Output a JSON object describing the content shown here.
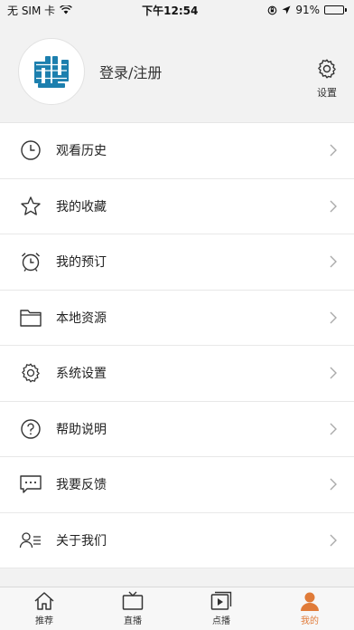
{
  "status": {
    "carrier": "无 SIM 卡",
    "time": "下午12:54",
    "battery": "91%",
    "battery_level": 0.91
  },
  "profile": {
    "login_label": "登录/注册",
    "settings_label": "设置"
  },
  "menu": [
    {
      "label": "观看历史",
      "icon": "clock-icon"
    },
    {
      "label": "我的收藏",
      "icon": "star-icon"
    },
    {
      "label": "我的预订",
      "icon": "alarm-clock-icon"
    },
    {
      "label": "本地资源",
      "icon": "folder-icon"
    },
    {
      "label": "系统设置",
      "icon": "gear-icon"
    },
    {
      "label": "帮助说明",
      "icon": "question-icon"
    },
    {
      "label": "我要反馈",
      "icon": "chat-icon"
    },
    {
      "label": "关于我们",
      "icon": "user-list-icon"
    }
  ],
  "tabs": [
    {
      "label": "推荐",
      "icon": "home-icon"
    },
    {
      "label": "直播",
      "icon": "tv-icon"
    },
    {
      "label": "点播",
      "icon": "play-icon"
    },
    {
      "label": "我的",
      "icon": "person-icon",
      "active": true
    }
  ],
  "colors": {
    "accent": "#e07b39",
    "logo_blue": "#1c7fae"
  }
}
